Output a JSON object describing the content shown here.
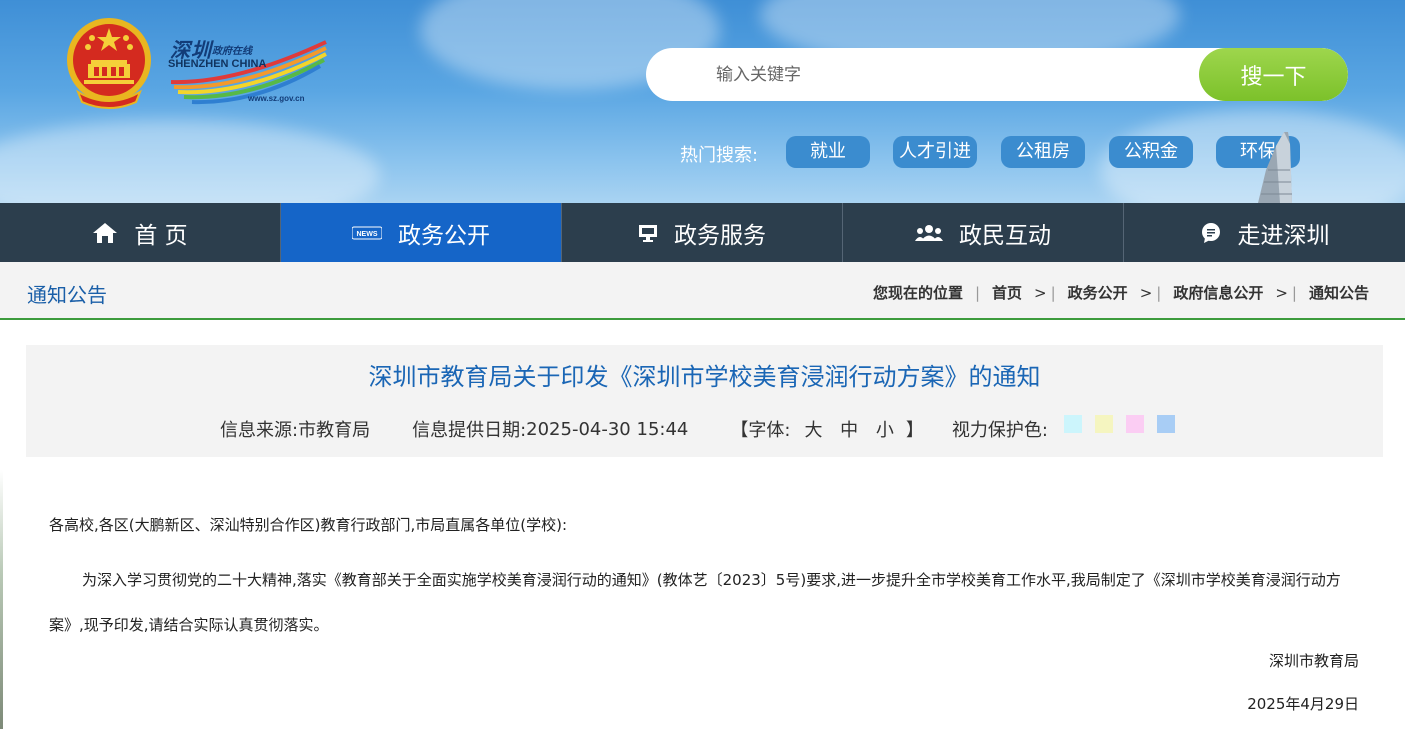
{
  "header": {
    "logo": {
      "chinese": "深圳",
      "subtitle": "政府在线",
      "english": "SHENZHEN CHINA",
      "url": "www.sz.gov.cn"
    },
    "search": {
      "placeholder": "输入关键字",
      "button_label": "搜一下"
    },
    "hot_search": {
      "label": "热门搜索:",
      "tags": [
        "就业",
        "人才引进",
        "公租房",
        "公积金",
        "环保"
      ]
    }
  },
  "nav": {
    "items": [
      {
        "label": "首 页",
        "icon": "home-icon"
      },
      {
        "label": "政务公开",
        "icon": "news-icon",
        "active": true
      },
      {
        "label": "政务服务",
        "icon": "monitor-icon"
      },
      {
        "label": "政民互动",
        "icon": "users-icon"
      },
      {
        "label": "走进深圳",
        "icon": "chat-icon"
      }
    ],
    "active_color": "#1565c8",
    "bg_color": "#2c3e4d"
  },
  "breadcrumb": {
    "section_title": "通知公告",
    "location_label": "您现在的位置",
    "items": [
      "首页",
      "政务公开",
      "政府信息公开",
      "通知公告"
    ]
  },
  "article": {
    "title": "深圳市教育局关于印发《深圳市学校美育浸润行动方案》的通知",
    "source_label": "信息来源:",
    "source": "市教育局",
    "date_label": "信息提供日期:",
    "date": "2025-04-30 15:44",
    "font_label": "【字体:",
    "font_sizes": [
      "大",
      "中",
      "小"
    ],
    "font_close": "】",
    "eye_label": "视力保护色:",
    "eye_colors": [
      "#ccf5fc",
      "#f5f5c0",
      "#fbcdf3",
      "#a8cdf5"
    ],
    "salutation": "各高校,各区(大鹏新区、深汕特别合作区)教育行政部门,市局直属各单位(学校):",
    "paragraph": "为深入学习贯彻党的二十大精神,落实《教育部关于全面实施学校美育浸润行动的通知》(教体艺〔2023〕5号)要求,进一步提升全市学校美育工作水平,我局制定了《深圳市学校美育浸润行动方案》,现予印发,请结合实际认真贯彻落实。",
    "signature": "深圳市教育局",
    "sign_date": "2025年4月29日"
  }
}
